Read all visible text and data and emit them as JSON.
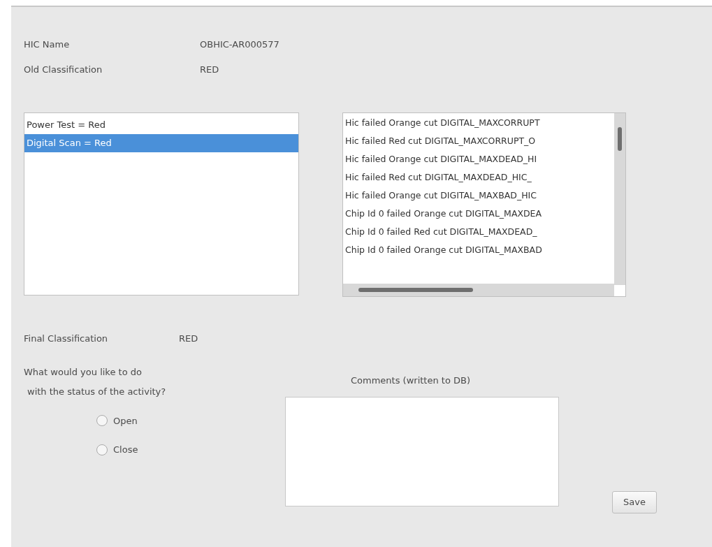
{
  "info": [
    {
      "label": "HIC Name",
      "value": "OBHIC-AR000577"
    },
    {
      "label": "Old Classification",
      "value": "RED"
    }
  ],
  "tests": [
    {
      "label": "Power Test = Red",
      "selected": false
    },
    {
      "label": "Digital Scan = Red",
      "selected": true
    }
  ],
  "messages": [
    "Hic failed Orange cut DIGITAL_MAXCORRUPT",
    "Hic failed Red cut DIGITAL_MAXCORRUPT_O",
    "Hic failed Orange cut DIGITAL_MAXDEAD_HI",
    "Hic failed Red cut DIGITAL_MAXDEAD_HIC_",
    "Hic failed Orange cut DIGITAL_MAXBAD_HIC",
    "Chip Id 0 failed Orange cut DIGITAL_MAXDEA",
    "Chip Id 0 failed Red cut DIGITAL_MAXDEAD_",
    "Chip Id 0 failed Orange cut DIGITAL_MAXBAD"
  ],
  "final": {
    "label": "Final Classification",
    "value": "RED"
  },
  "question": [
    "What would you like to do",
    "with the status of the activity?"
  ],
  "status_options": [
    {
      "label": "Open",
      "selected": false
    },
    {
      "label": "Close",
      "selected": false
    }
  ],
  "comments": {
    "label": "Comments (written to DB)"
  },
  "save_button": "Save"
}
